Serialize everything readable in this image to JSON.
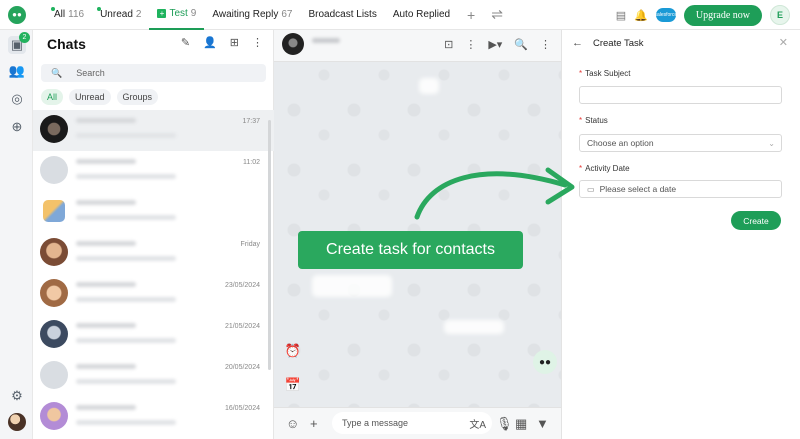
{
  "tabs": [
    {
      "label": "All",
      "count": "116"
    },
    {
      "label": "Unread",
      "count": "2"
    },
    {
      "label": "Test",
      "count": "9"
    },
    {
      "label": "Awaiting Reply",
      "count": "67"
    },
    {
      "label": "Broadcast Lists",
      "count": ""
    },
    {
      "label": "Auto Replied",
      "count": ""
    }
  ],
  "topbar": {
    "upgrade_label": "Upgrade now",
    "user_initial": "E",
    "salesforce_label": "salesforce"
  },
  "rail": {
    "badge": "2"
  },
  "chats": {
    "title": "Chats",
    "search_placeholder": "Search",
    "filters": [
      "All",
      "Unread",
      "Groups"
    ],
    "times": [
      "17:37",
      "11:02",
      "",
      "Friday",
      "23/05/2024",
      "21/05/2024",
      "20/05/2024",
      "16/05/2024"
    ]
  },
  "conversation": {
    "message_placeholder": "Type a message"
  },
  "task_panel": {
    "title": "Create Task",
    "subject_label": "Task Subject",
    "status_label": "Status",
    "status_placeholder": "Choose an option",
    "date_label": "Activity Date",
    "date_placeholder": "Please select a date",
    "required_mark": "*",
    "create_label": "Create"
  },
  "callout": {
    "text": "Create task for contacts"
  },
  "colors": {
    "accent": "#1e9e58",
    "callout": "#2aa85e"
  }
}
